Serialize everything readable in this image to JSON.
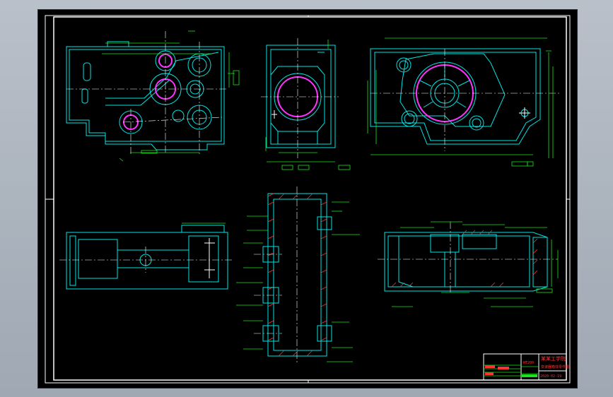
{
  "title_block": {
    "title": "某某工学院",
    "subtitle": "变速器箱体零件图",
    "date": "2020-02-19",
    "tag": "HT200"
  },
  "colors": {
    "outline": "#ffffff",
    "body": "#00e5e5",
    "dimension": "#19e619",
    "bore": "#ff33ff",
    "title": "#ff3333",
    "background": "#000000"
  }
}
